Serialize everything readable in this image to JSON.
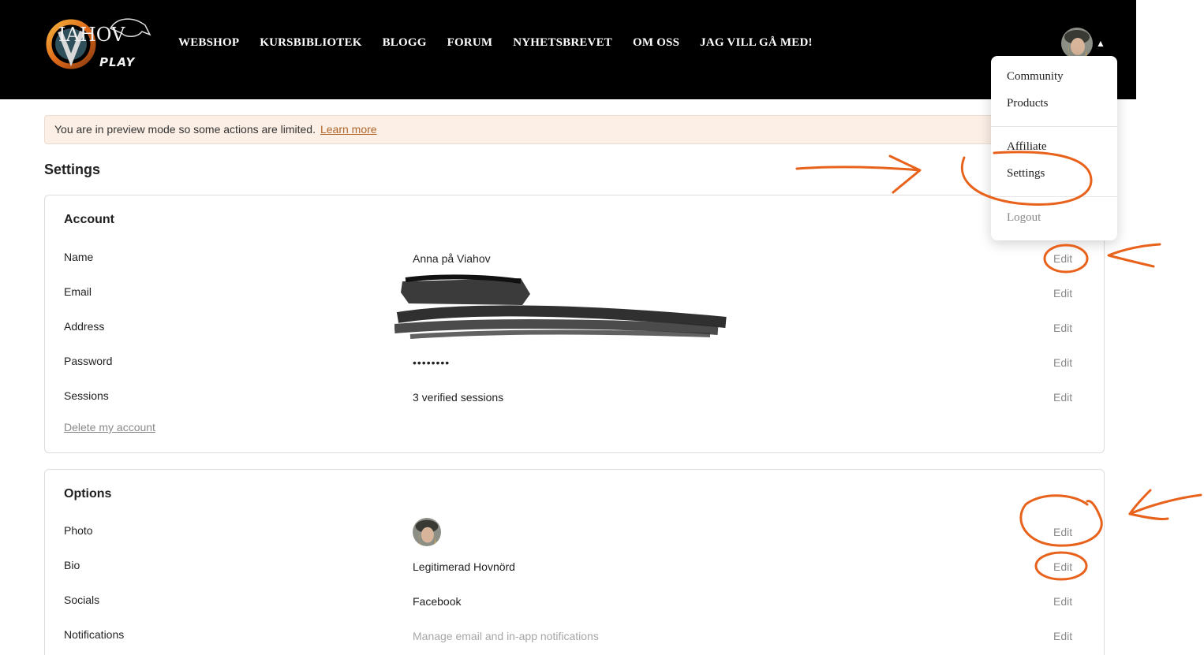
{
  "header": {
    "logo_text": "IAHOV",
    "logo_sub": "PLAY",
    "nav": [
      "WEBSHOP",
      "KURSBIBLIOTEK",
      "BLOGG",
      "FORUM",
      "NYHETSBREVET",
      "OM OSS",
      "JAG VILL GÅ MED!"
    ]
  },
  "banner": {
    "text": "You are in preview mode so some actions are limited.",
    "link": "Learn more"
  },
  "page_title": "Settings",
  "account": {
    "title": "Account",
    "rows": [
      {
        "label": "Name",
        "value": "Anna på Viahov",
        "edit": "Edit"
      },
      {
        "label": "Email",
        "value": "",
        "edit": "Edit"
      },
      {
        "label": "Address",
        "value": "",
        "edit": "Edit"
      },
      {
        "label": "Password",
        "value": "••••••••",
        "edit": "Edit"
      },
      {
        "label": "Sessions",
        "value": "3 verified sessions",
        "edit": "Edit"
      }
    ],
    "delete_label": "Delete my account"
  },
  "options": {
    "title": "Options",
    "rows": [
      {
        "label": "Photo",
        "value": "",
        "edit": "Edit"
      },
      {
        "label": "Bio",
        "value": "Legitimerad Hovnörd",
        "edit": "Edit"
      },
      {
        "label": "Socials",
        "value": "Facebook",
        "edit": "Edit"
      },
      {
        "label": "Notifications",
        "value": "Manage email and in-app notifications",
        "edit": "Edit"
      }
    ]
  },
  "dropdown": {
    "items": [
      "Community",
      "Products",
      "Affiliate",
      "Settings",
      "Logout"
    ]
  },
  "colors": {
    "annotation": "#e8621b",
    "header_bg": "#000000",
    "banner_bg": "#fbefe6"
  }
}
